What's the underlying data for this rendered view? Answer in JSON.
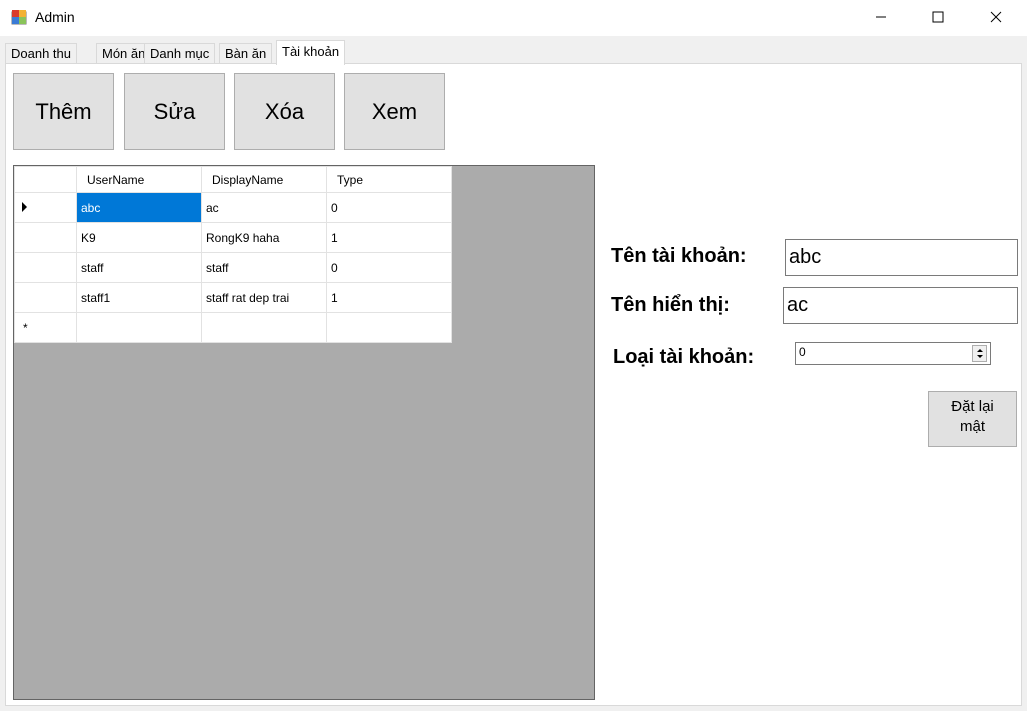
{
  "window": {
    "title": "Admin",
    "icon": "winforms-app-icon",
    "controls": [
      "minimize-icon",
      "maximize-icon",
      "close-icon"
    ]
  },
  "tabs": [
    {
      "label": "Doanh thu",
      "active": false
    },
    {
      "label": "Món ăn",
      "active": false
    },
    {
      "label": "Danh mục",
      "active": false
    },
    {
      "label": "Bàn ăn",
      "active": false
    },
    {
      "label": "Tài khoản",
      "active": true
    }
  ],
  "toolbar": {
    "add_label": "Thêm",
    "edit_label": "Sửa",
    "delete_label": "Xóa",
    "view_label": "Xem"
  },
  "grid": {
    "columns": [
      "UserName",
      "DisplayName",
      "Type"
    ],
    "rows": [
      {
        "user": "abc",
        "display": "ac",
        "type": "0"
      },
      {
        "user": "K9",
        "display": "RongK9 haha",
        "type": "1"
      },
      {
        "user": "staff",
        "display": "staff",
        "type": "0"
      },
      {
        "user": "staff1",
        "display": "staff rat dep trai",
        "type": "1"
      }
    ],
    "new_row_marker": "*",
    "selection_color": "#0078d7"
  },
  "form": {
    "username_label": "Tên tài khoản:",
    "username_value": "abc",
    "displayname_label": "Tên hiển thị:",
    "displayname_value": "ac",
    "type_label": "Loại tài khoản:",
    "type_value": "0",
    "reset_password_label_line1": "Đặt lại",
    "reset_password_label_line2": "mật"
  }
}
